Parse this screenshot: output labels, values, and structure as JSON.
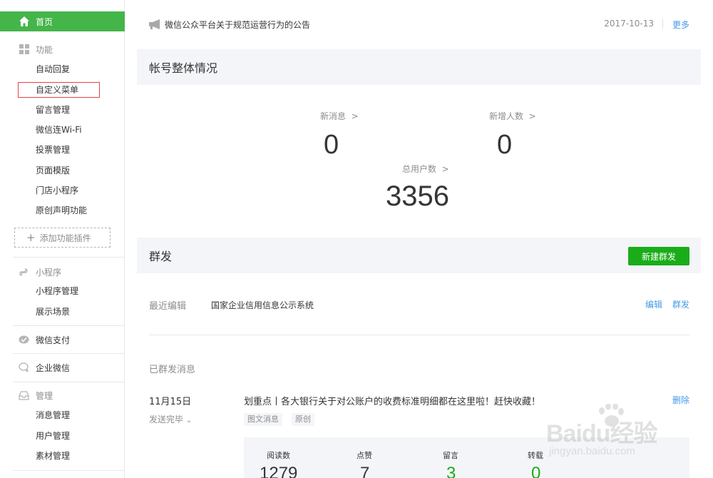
{
  "sidebar": {
    "home": "首页",
    "functions": {
      "title": "功能",
      "items": [
        "自动回复",
        "自定义菜单",
        "留言管理",
        "微信连Wi-Fi",
        "投票管理",
        "页面模版",
        "门店小程序",
        "原创声明功能"
      ],
      "add_plugin": "添加功能插件"
    },
    "miniprogram": {
      "title": "小程序",
      "items": [
        "小程序管理",
        "展示场景"
      ]
    },
    "wechat_pay": "微信支付",
    "enterprise": "企业微信",
    "manage": {
      "title": "管理",
      "items": [
        "消息管理",
        "用户管理",
        "素材管理"
      ]
    }
  },
  "notice": {
    "text": "微信公众平台关于规范运营行为的公告",
    "date": "2017-10-13",
    "more": "更多"
  },
  "account": {
    "title": "帐号整体情况",
    "new_messages_label": "新消息",
    "new_messages_value": "0",
    "new_users_label": "新增人数",
    "new_users_value": "0",
    "total_users_label": "总用户数",
    "total_users_value": "3356"
  },
  "broadcast": {
    "title": "群发",
    "new_button": "新建群发",
    "recent_label": "最近编辑",
    "recent_title": "国家企业信用信息公示系统",
    "edit": "编辑",
    "send": "群发",
    "sent_label": "已群发消息",
    "item": {
      "date": "11月15日",
      "status": "发送完毕",
      "title": "划重点丨各大银行关于对公账户的收费标准明细都在这里啦！赶快收藏！",
      "delete": "删除",
      "tags": [
        "图文消息",
        "原创"
      ],
      "stats": {
        "reads_label": "阅读数",
        "reads": "1279",
        "likes_label": "点赞",
        "likes": "7",
        "comments_label": "留言",
        "comments": "3",
        "shares_label": "转载",
        "shares": "0"
      }
    }
  },
  "watermark": {
    "main": "Baidu经验",
    "sub": "jingyan.baidu.com"
  },
  "colors": {
    "accent_green": "#44b549",
    "button_green": "#1aad19",
    "link_blue": "#459ae9",
    "highlight_red": "#e24444"
  }
}
